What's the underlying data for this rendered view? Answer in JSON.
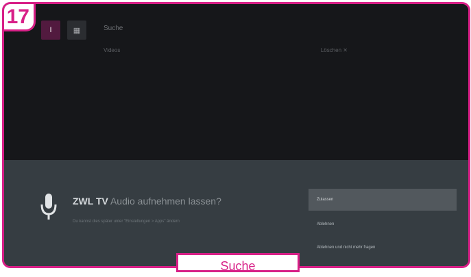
{
  "step_number": "17",
  "caption": "Suche",
  "top_bar": {
    "button1_label": "I",
    "button2_label": "▦",
    "search_label": "Suche",
    "sub_left": "Videos",
    "sub_right": "Löschen ✕"
  },
  "dialog": {
    "app_name": "ZWL TV",
    "title_rest": "Audio aufnehmen lassen?",
    "description": "Du kannst dies später unter \"Einstellungen > Apps\" ändern",
    "options": [
      "Zulassen",
      "Ablehnen",
      "Ablehnen und nicht mehr fragen"
    ]
  },
  "colors": {
    "accent": "#d81f87",
    "tv_background": "#16171a",
    "dialog_background": "#363d42",
    "selected_option": "#52585d"
  }
}
